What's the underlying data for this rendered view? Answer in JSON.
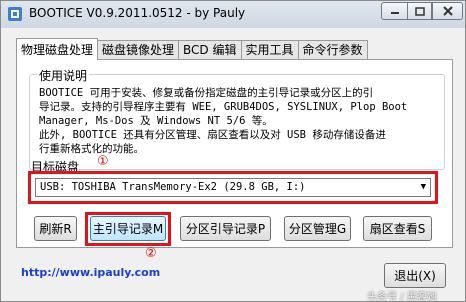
{
  "window": {
    "title": "BOOTICE V0.9.2011.0512 - by Pauly"
  },
  "tabs": [
    {
      "label": "物理磁盘处理"
    },
    {
      "label": "磁盘镜像处理"
    },
    {
      "label": "BCD 编辑"
    },
    {
      "label": "实用工具"
    },
    {
      "label": "命令行参数"
    }
  ],
  "usage": {
    "title": "使用说明",
    "text": "BOOTICE 可用于安装、修复或备份指定磁盘的主引导记录或分区上的引\n导记录。支持的引导程序主要有 WEE, GRUB4DOS, SYSLINUX, Plop Boot\nManager, Ms-Dos 及 Windows NT 5/6 等。\n此外, BOOTICE 还具有分区管理、扇区查看以及对 USB 移动存储设备进\n行重新格式化的功能。"
  },
  "target_disk": {
    "label": "目标磁盘",
    "selected": "USB: TOSHIBA TransMemory-Ex2 (29.8 GB, I:)"
  },
  "annotations": {
    "marker1": "①",
    "marker2": "②"
  },
  "buttons": {
    "refresh": "刷新R",
    "mbr": "主引导记录M",
    "pbr": "分区引导记录P",
    "parts": "分区管理G",
    "sector": "扇区查看S",
    "exit": "退出(X)"
  },
  "footer": {
    "link": "http://www.ipauly.com",
    "watermark": "头条号 / 黑客她"
  },
  "colors": {
    "highlight": "#e0141c",
    "link": "#1a3fd0"
  }
}
